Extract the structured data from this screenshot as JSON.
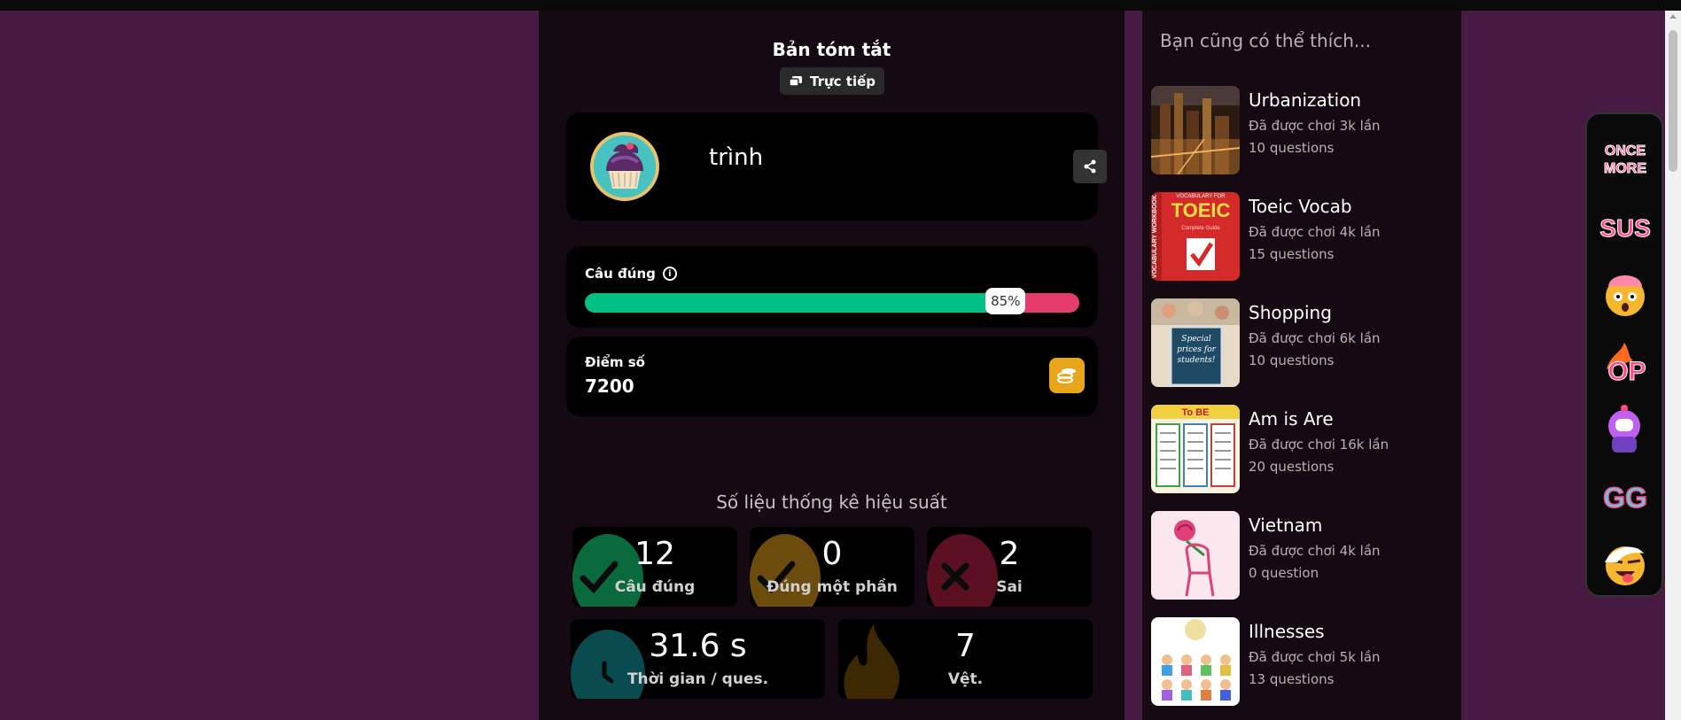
{
  "summary": {
    "title": "Bản tóm tắt",
    "live_label": "Trực tiếp"
  },
  "player": {
    "name": "trình"
  },
  "accuracy": {
    "label": "Câu đúng",
    "percent": 85,
    "percent_label": "85%"
  },
  "score": {
    "label": "Điểm số",
    "value": "7200"
  },
  "performance": {
    "title": "Số liệu thống kê hiệu suất",
    "correct": {
      "value": "12",
      "label": "Câu đúng"
    },
    "partial": {
      "value": "0",
      "label": "Đúng một phần"
    },
    "wrong": {
      "value": "2",
      "label": "Sai"
    },
    "time": {
      "value": "31.6 s",
      "label": "Thời gian / ques."
    },
    "streak": {
      "value": "7",
      "label": "Vệt."
    }
  },
  "sidebar": {
    "title": "Bạn cũng có thể thích...",
    "items": [
      {
        "name": "Urbanization",
        "plays": "Đã được chơi 3k lần",
        "questions": "10 questions"
      },
      {
        "name": "Toeic Vocab",
        "plays": "Đã được chơi 4k lần",
        "questions": "15 questions"
      },
      {
        "name": "Shopping",
        "plays": "Đã được chơi 6k lần",
        "questions": "10 questions"
      },
      {
        "name": "Am is Are",
        "plays": "Đã được chơi 16k lần",
        "questions": "20 questions"
      },
      {
        "name": "Vietnam",
        "plays": "Đã được chơi 4k lần",
        "questions": "0 question"
      },
      {
        "name": "Illnesses",
        "plays": "Đã được chơi 5k lần",
        "questions": "13 questions"
      }
    ]
  },
  "thumb_text": {
    "toeic_header": "VOCABULARY FOR",
    "toeic_title": "TOEIC",
    "toeic_spine": "VOCABULARY WORKBOOK",
    "toeic_sub": "Complete Guide",
    "shopping_sign": "Special prices for students!",
    "amisare_header": "To BE"
  },
  "reactions": [
    {
      "icon": "once-more-sticker-icon",
      "text": "ONCE MORE"
    },
    {
      "icon": "sus-sticker-icon",
      "text": "SUS"
    },
    {
      "icon": "mind-blown-sticker-icon"
    },
    {
      "icon": "op-sticker-icon",
      "text": "OP"
    },
    {
      "icon": "astronaut-sticker-icon"
    },
    {
      "icon": "gg-sticker-icon",
      "text": "GG"
    },
    {
      "icon": "tongue-out-sticker-icon"
    }
  ],
  "colors": {
    "page_bg": "#461a42",
    "panel_bg": "#150a12",
    "correct": "#00c083",
    "wrong": "#e63c6b",
    "coin": "#e8a71b"
  }
}
